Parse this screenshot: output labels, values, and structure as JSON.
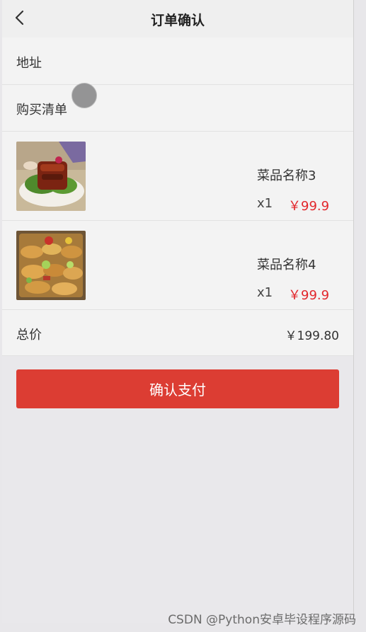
{
  "header": {
    "title": "订单确认",
    "back_icon": "chevron-left-icon"
  },
  "address": {
    "label": "地址"
  },
  "cart": {
    "label": "购买清单"
  },
  "items": [
    {
      "name": "菜品名称3",
      "qty": "x1",
      "price": "￥99.9"
    },
    {
      "name": "菜品名称4",
      "qty": "x1",
      "price": "￥99.9"
    }
  ],
  "total": {
    "label": "总价",
    "value": "￥199.80"
  },
  "pay_button": {
    "label": "确认支付"
  },
  "colors": {
    "accent": "#dc3d33",
    "price": "#e2262b",
    "background": "#e9e8eb"
  },
  "watermark": "CSDN @Python安卓毕设程序源码"
}
